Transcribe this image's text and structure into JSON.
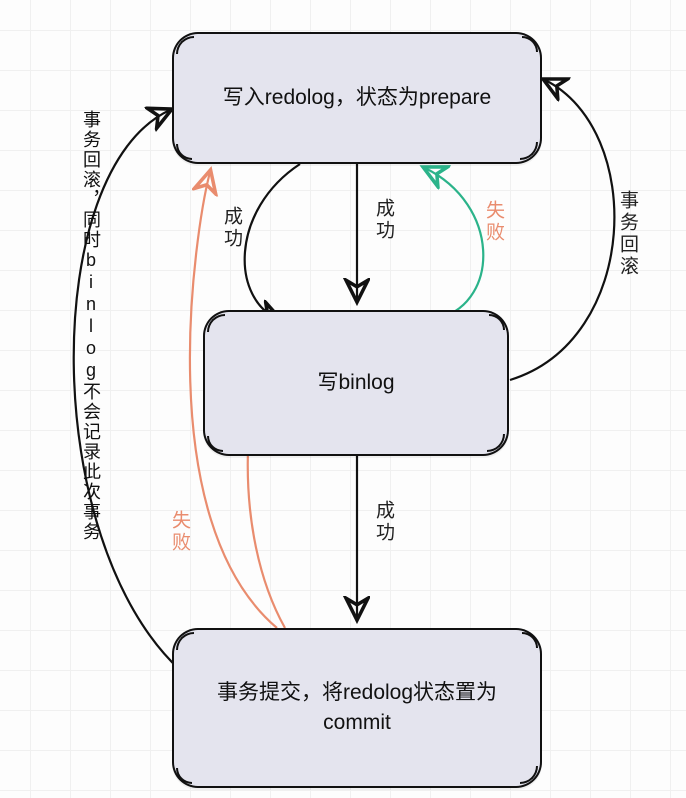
{
  "diagram": {
    "nodes": {
      "n1": "写入redolog，状态为prepare",
      "n2": "写binlog",
      "n3": "事务提交，将redolog状态置为commit"
    },
    "edges": {
      "n1_n2_success": "成功",
      "n1_n2_success_left": "成功",
      "n2_n3_success": "成功",
      "n2_n1_fail": "失败",
      "n2_n1_rollback": "事务回滚",
      "n3_n1_fail": "失败",
      "n3_n1_longnote": "事务回滚，同时binlog不会记录此次事务"
    }
  },
  "colors": {
    "node_fill": "#e4e4ee",
    "stroke": "#111111",
    "fail": "#e98c6e",
    "rollback_green": "#2bb38a"
  }
}
